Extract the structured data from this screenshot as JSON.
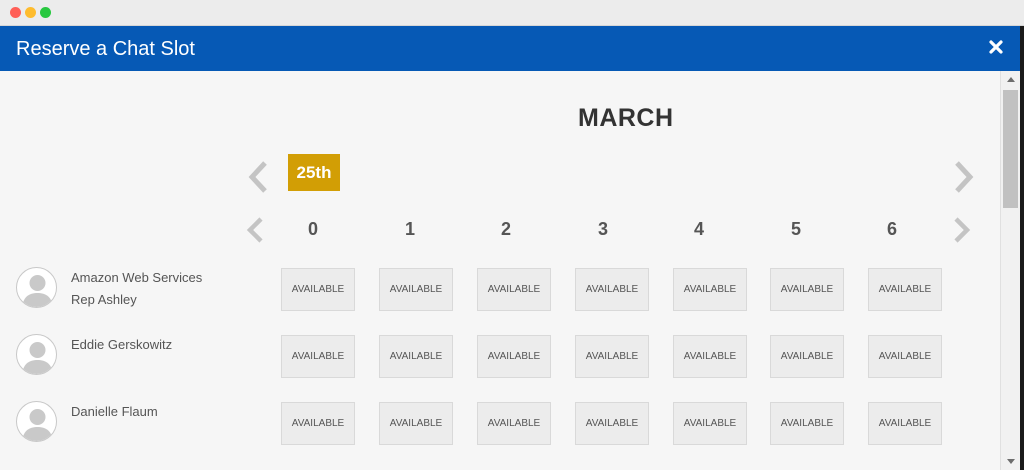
{
  "modal": {
    "title": "Reserve a Chat Slot"
  },
  "calendar": {
    "month": "MARCH",
    "selected_date": "25th",
    "columns": [
      "0",
      "1",
      "2",
      "3",
      "4",
      "5",
      "6"
    ]
  },
  "reps": [
    {
      "name_line1": "Amazon Web Services",
      "name_line2": "Rep Ashley",
      "slots": [
        "AVAILABLE",
        "AVAILABLE",
        "AVAILABLE",
        "AVAILABLE",
        "AVAILABLE",
        "AVAILABLE",
        "AVAILABLE"
      ]
    },
    {
      "name_line1": "Eddie Gerskowitz",
      "name_line2": "",
      "slots": [
        "AVAILABLE",
        "AVAILABLE",
        "AVAILABLE",
        "AVAILABLE",
        "AVAILABLE",
        "AVAILABLE",
        "AVAILABLE"
      ]
    },
    {
      "name_line1": "Danielle Flaum",
      "name_line2": "",
      "slots": [
        "AVAILABLE",
        "AVAILABLE",
        "AVAILABLE",
        "AVAILABLE",
        "AVAILABLE",
        "AVAILABLE",
        "AVAILABLE"
      ]
    }
  ],
  "colors": {
    "header": "#0659b5",
    "date_badge": "#d29e05",
    "chevron": "#c4c4c4"
  },
  "icons": {
    "close": "close-icon",
    "avatar": "user-silhouette-icon",
    "prev": "chevron-left-icon",
    "next": "chevron-right-icon"
  }
}
